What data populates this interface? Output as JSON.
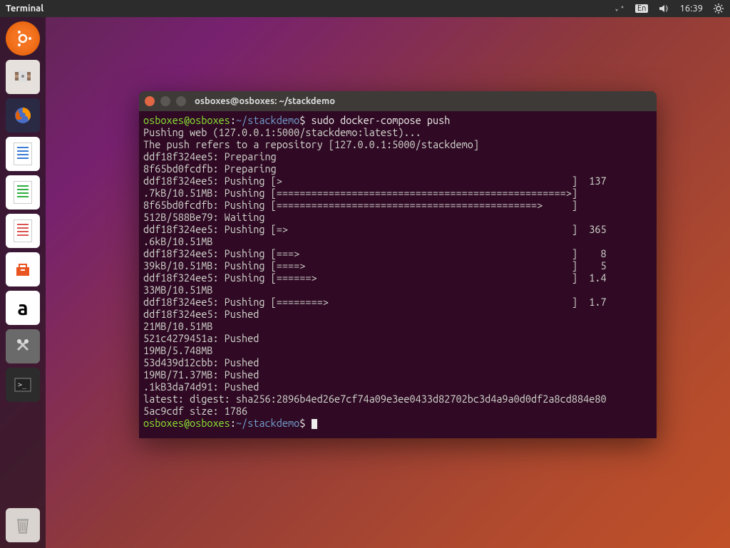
{
  "topbar": {
    "title": "Terminal",
    "lang": "En",
    "time": "16:39"
  },
  "launcher": {
    "items": [
      {
        "name": "dash",
        "label": ""
      },
      {
        "name": "files",
        "label": ""
      },
      {
        "name": "firefox",
        "label": ""
      },
      {
        "name": "writer",
        "label": ""
      },
      {
        "name": "calc",
        "label": ""
      },
      {
        "name": "impress",
        "label": ""
      },
      {
        "name": "software",
        "label": ""
      },
      {
        "name": "amazon",
        "label": "a"
      },
      {
        "name": "settings",
        "label": ""
      },
      {
        "name": "terminal",
        "label": ""
      }
    ]
  },
  "terminal": {
    "window_title": "osboxes@osboxes: ~/stackdemo",
    "prompt_user": "osboxes@osboxes",
    "prompt_sep": ":",
    "prompt_path": "~/stackdemo",
    "prompt_end": "$ ",
    "command": "sudo docker-compose push",
    "lines": [
      "Pushing web (127.0.0.1:5000/stackdemo:latest)...",
      "The push refers to a repository [127.0.0.1:5000/stackdemo]",
      "ddf18f324ee5: Preparing",
      "8f65bd0fcdfb: Preparing",
      "ddf18f324ee5: Pushing [>                                                  ]  137",
      ".7kB/10.51MB: Pushing [==================================================>]",
      "8f65bd0fcdfb: Pushing [=============================================>     ]",
      "512B/588Be79: Waiting",
      "ddf18f324ee5: Pushing [=>                                                 ]  365",
      ".6kB/10.51MB",
      "ddf18f324ee5: Pushing [===>                                               ]    8",
      "39kB/10.51MB: Pushing [====>                                              ]    5",
      "ddf18f324ee5: Pushing [======>                                            ]  1.4",
      "33MB/10.51MB",
      "ddf18f324ee5: Pushing [========>                                          ]  1.7",
      "ddf18f324ee5: Pushed",
      "21MB/10.51MB",
      "521c4279451a: Pushed",
      "19MB/5.748MB",
      "53d439d12cbb: Pushed",
      "19MB/71.37MB: Pushed",
      ".1kB3da74d91: Pushed",
      "latest: digest: sha256:2896b4ed26e7cf74a09e3ee0433d82702bc3d4a9a0d0df2a8cd884e80",
      "5ac9cdf size: 1786"
    ]
  }
}
